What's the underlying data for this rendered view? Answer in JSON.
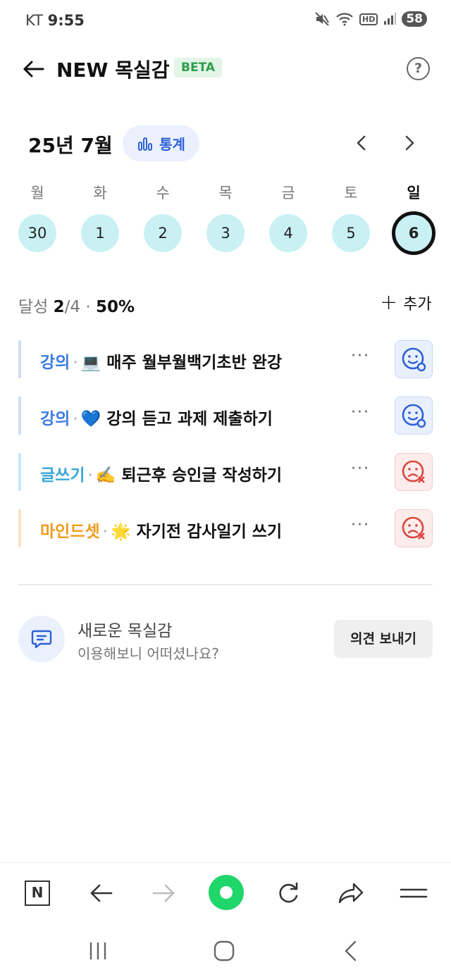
{
  "status_bar": {
    "carrier": "KT",
    "time": "9:55",
    "hd_label": "HD",
    "battery": "58"
  },
  "header": {
    "title": "NEW 목실감",
    "badge": "BETA",
    "help_glyph": "?"
  },
  "calendar": {
    "month_label": "25년 7월",
    "stats_label": "통계",
    "weekdays": [
      "월",
      "화",
      "수",
      "목",
      "금",
      "토",
      "일"
    ],
    "days": [
      "30",
      "1",
      "2",
      "3",
      "4",
      "5",
      "6"
    ],
    "selected_index": 6
  },
  "progress": {
    "label": "달성",
    "done": "2",
    "total": "/4",
    "sep": "·",
    "percent": "50%",
    "add_label": "추가"
  },
  "tasks": [
    {
      "category": "강의",
      "category_color": "#3d7be0",
      "bar_color": "#cfdcf6",
      "emoji": "💻",
      "text": "매주 월부월백기초반 완강",
      "status": "success"
    },
    {
      "category": "강의",
      "category_color": "#3d7be0",
      "bar_color": "#cfdcf6",
      "emoji": "💙",
      "text": "강의 듣고 과제 제출하기",
      "status": "success"
    },
    {
      "category": "글쓰기",
      "category_color": "#39a6d6",
      "bar_color": "#c8e7f5",
      "emoji": "✍️",
      "text": "퇴근후 승인글 작성하기",
      "status": "fail"
    },
    {
      "category": "마인드셋",
      "category_color": "#f09a1a",
      "bar_color": "#fde1c2",
      "emoji": "🌟",
      "text": "자기전 감사일기 쓰기",
      "status": "fail"
    }
  ],
  "feedback": {
    "title": "새로운 목실감",
    "subtitle": "이용해보니 어떠셨나요?",
    "button": "의견 보내기"
  },
  "toolbar": {
    "home_label": "N"
  },
  "colors": {
    "accent_blue": "#2e5fd6",
    "day_circle": "#c9f1f4",
    "success_face": "#2e5fd6",
    "fail_face": "#d9473d",
    "green": "#1fd66b"
  }
}
